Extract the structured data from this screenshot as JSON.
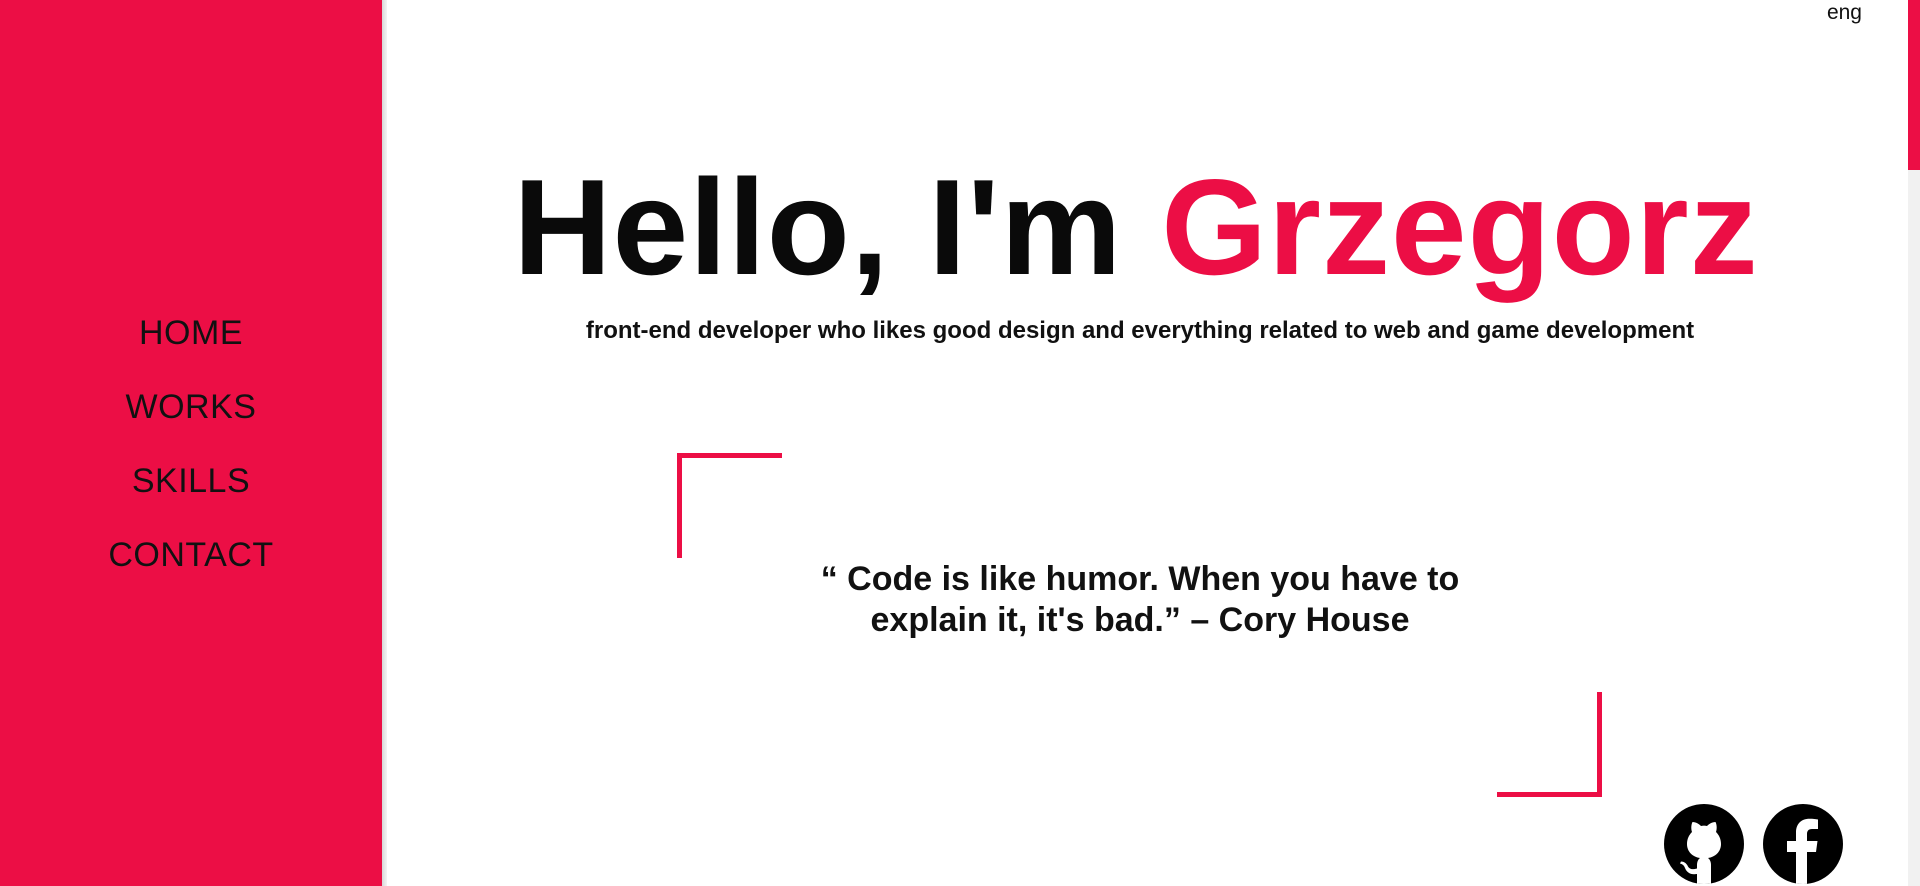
{
  "sidebar": {
    "items": [
      {
        "label": "HOME"
      },
      {
        "label": "WORKS"
      },
      {
        "label": "SKILLS"
      },
      {
        "label": "CONTACT"
      }
    ]
  },
  "language": "eng",
  "hero": {
    "greeting": "Hello, I'm ",
    "name": "Grzegorz",
    "subtitle": "front-end developer who likes good design and everything related to web and game development"
  },
  "quote": {
    "text": "“ Code is like humor. When you have to explain it, it's bad.” – Cory House"
  },
  "socials": [
    {
      "icon": "github-icon"
    },
    {
      "icon": "facebook-icon"
    }
  ],
  "colors": {
    "accent": "#ec0e45",
    "text": "#111111",
    "background": "#ffffff"
  }
}
